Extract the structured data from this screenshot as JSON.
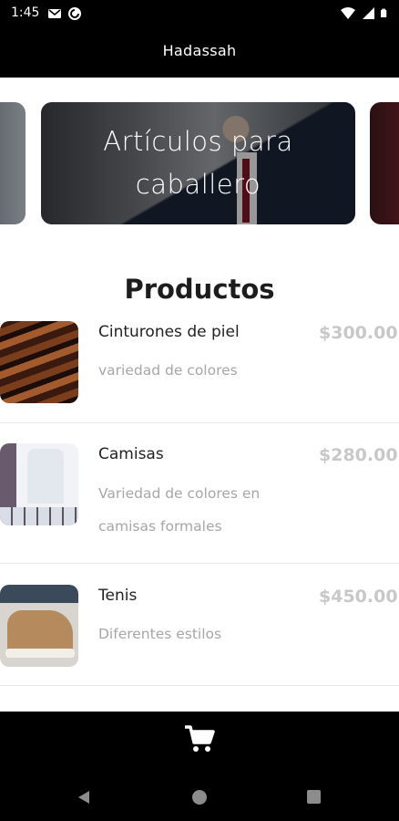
{
  "status_bar": {
    "time": "1:45",
    "icons_left": [
      "gmail-icon",
      "pocket-casts-icon"
    ],
    "icons_right": [
      "wifi-icon",
      "signal-icon",
      "battery-icon"
    ]
  },
  "app_bar": {
    "title": "Hadassah"
  },
  "carousel": {
    "items": [
      {
        "title": "Artículos para caballero"
      }
    ]
  },
  "section": {
    "title": "Productos"
  },
  "products": [
    {
      "name": "Cinturones de piel",
      "description": "variedad de colores",
      "price": "$300.00",
      "image": "belts-image"
    },
    {
      "name": "Camisas",
      "description": "Variedad de colores en camisas formales",
      "price": "$280.00",
      "image": "shirts-image"
    },
    {
      "name": "Tenis",
      "description": "Diferentes estilos",
      "price": "$450.00",
      "image": "shoes-image"
    }
  ],
  "bottom_bar": {
    "icon": "cart-icon"
  },
  "colors": {
    "bar": "#000000",
    "price": "#c8c8c8",
    "description": "#a6a6a6"
  }
}
